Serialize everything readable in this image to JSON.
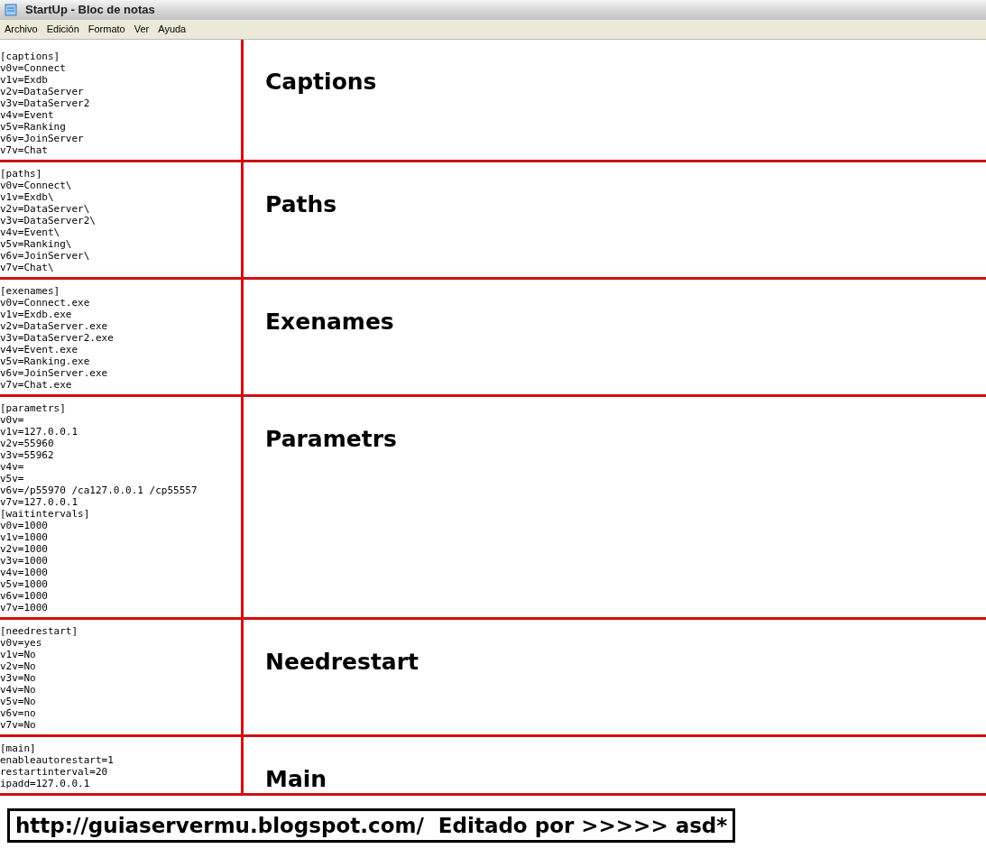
{
  "window": {
    "title": "StartUp - Bloc de notas"
  },
  "menu": [
    "Archivo",
    "Edición",
    "Formato",
    "Ver",
    "Ayuda"
  ],
  "sections": [
    {
      "lines": [
        "[captions]",
        "v0v=Connect",
        "v1v=Exdb",
        "v2v=DataServer",
        "v3v=DataServer2",
        "v4v=Event",
        "v5v=Ranking",
        "v6v=JoinServer",
        "v7v=Chat"
      ],
      "label": "Captions"
    },
    {
      "lines": [
        "[paths]",
        "v0v=Connect\\",
        "v1v=Exdb\\",
        "v2v=DataServer\\",
        "v3v=DataServer2\\",
        "v4v=Event\\",
        "v5v=Ranking\\",
        "v6v=JoinServer\\",
        "v7v=Chat\\"
      ],
      "label": "Paths"
    },
    {
      "lines": [
        "[exenames]",
        "v0v=Connect.exe",
        "v1v=Exdb.exe",
        "v2v=DataServer.exe",
        "v3v=DataServer2.exe",
        "v4v=Event.exe",
        "v5v=Ranking.exe",
        "v6v=JoinServer.exe",
        "v7v=Chat.exe"
      ],
      "label": "Exenames"
    },
    {
      "lines": [
        "[parametrs]",
        "v0v=",
        "v1v=127.0.0.1",
        "v2v=55960",
        "v3v=55962",
        "v4v=",
        "v5v=",
        "v6v=/p55970 /ca127.0.0.1 /cp55557",
        "v7v=127.0.0.1",
        "[waitintervals]",
        "v0v=1000",
        "v1v=1000",
        "v2v=1000",
        "v3v=1000",
        "v4v=1000",
        "v5v=1000",
        "v6v=1000",
        "v7v=1000"
      ],
      "label": "Parametrs"
    },
    {
      "lines": [
        "[needrestart]",
        "v0v=yes",
        "v1v=No",
        "v2v=No",
        "v3v=No",
        "v4v=No",
        "v5v=No",
        "v6v=no",
        "v7v=No"
      ],
      "label": "Needrestart"
    },
    {
      "lines": [
        "[main]",
        "enableautorestart=1",
        "restartinterval=20",
        "ipadd=127.0.0.1"
      ],
      "label": "Main"
    }
  ],
  "footer": "http://guiaservermu.blogspot.com/  Editado por >>>>> asd*"
}
